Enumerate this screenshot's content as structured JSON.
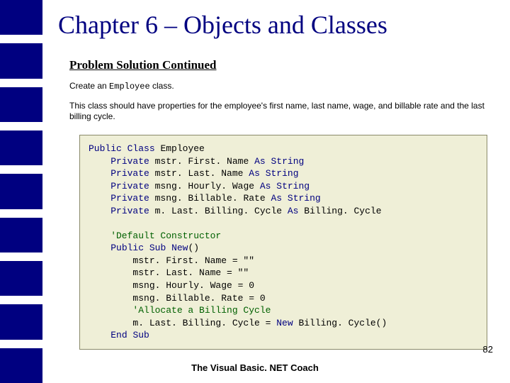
{
  "title": "Chapter 6 – Objects and Classes",
  "subtitle": "Problem Solution Continued",
  "line1_prefix": "Create an ",
  "line1_code": "Employee",
  "line1_suffix": " class.",
  "line2": "This class should have properties for the employee's first name, last name, wage, and billable rate and the last billing cycle.",
  "code": {
    "l01a": "Public",
    "l01b": " ",
    "l01c": "Class",
    "l01d": " Employee",
    "l02a": "    ",
    "l02b": "Private",
    "l02c": " mstr. First. Name ",
    "l02d": "As",
    "l02e": " ",
    "l02f": "String",
    "l03a": "    ",
    "l03b": "Private",
    "l03c": " mstr. Last. Name ",
    "l03d": "As",
    "l03e": " ",
    "l03f": "String",
    "l04a": "    ",
    "l04b": "Private",
    "l04c": " msng. Hourly. Wage ",
    "l04d": "As",
    "l04e": " ",
    "l04f": "String",
    "l05a": "    ",
    "l05b": "Private",
    "l05c": " msng. Billable. Rate ",
    "l05d": "As",
    "l05e": " ",
    "l05f": "String",
    "l06a": "    ",
    "l06b": "Private",
    "l06c": " m. Last. Billing. Cycle ",
    "l06d": "As",
    "l06e": " Billing. Cycle",
    "blank": "",
    "l07": "    'Default Constructor",
    "l08a": "    ",
    "l08b": "Public",
    "l08c": " ",
    "l08d": "Sub",
    "l08e": " ",
    "l08f": "New",
    "l08g": "()",
    "l09": "        mstr. First. Name = \"\"",
    "l10": "        mstr. Last. Name = \"\"",
    "l11": "        msng. Hourly. Wage = 0",
    "l12": "        msng. Billable. Rate = 0",
    "l13": "        'Allocate a Billing Cycle",
    "l14a": "        m. Last. Billing. Cycle = ",
    "l14b": "New",
    "l14c": " Billing. Cycle()",
    "l15a": "    ",
    "l15b": "End",
    "l15c": " ",
    "l15d": "Sub"
  },
  "page_number": "82",
  "footer": "The Visual Basic. NET Coach"
}
